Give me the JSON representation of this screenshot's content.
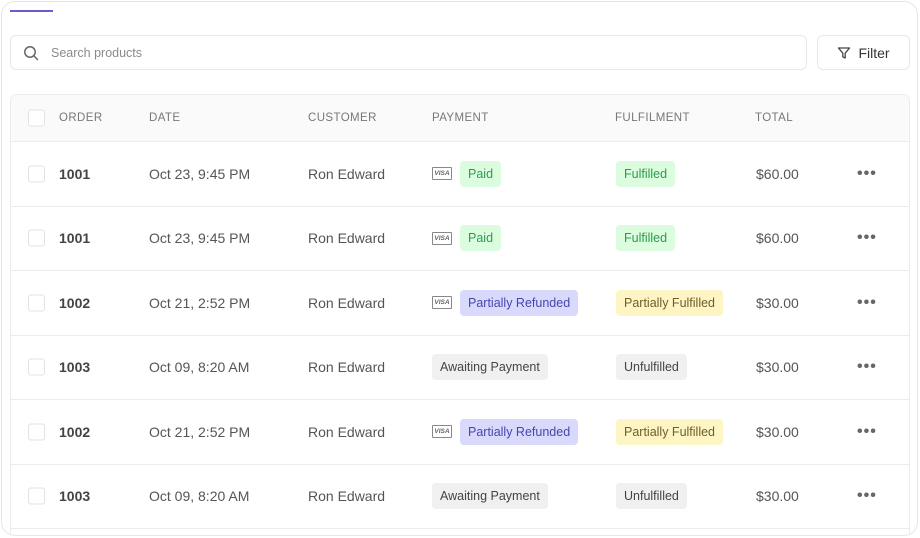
{
  "search": {
    "placeholder": "Search products",
    "value": ""
  },
  "toolbar": {
    "filter_label": "Filter"
  },
  "colors": {
    "accent": "#6b5bd2",
    "paid_bg": "#dcfce0",
    "paid_fg": "#2e9a4e",
    "refund_bg": "#d9d9fb",
    "refund_fg": "#4a44b0",
    "partial_bg": "#fdf5c4",
    "partial_fg": "#6f5e2a",
    "neutral_bg": "#f0f0f0",
    "neutral_fg": "#444444"
  },
  "table": {
    "columns": [
      "ORDER",
      "DATE",
      "CUSTOMER",
      "PAYMENT",
      "FULFILMENT",
      "TOTAL"
    ],
    "rows": [
      {
        "order": "1001",
        "date": "Oct 23,  9:45 PM",
        "customer": "Ron Edward",
        "card": "VISA",
        "payment": "Paid",
        "payment_kind": "paid",
        "fulfilment": "Fulfilled",
        "fulfilment_kind": "paid",
        "total": "$60.00"
      },
      {
        "order": "1001",
        "date": "Oct 23,  9:45 PM",
        "customer": "Ron Edward",
        "card": "VISA",
        "payment": "Paid",
        "payment_kind": "paid",
        "fulfilment": "Fulfilled",
        "fulfilment_kind": "paid",
        "total": "$60.00"
      },
      {
        "order": "1002",
        "date": "Oct 21,  2:52 PM",
        "customer": "Ron Edward",
        "card": "VISA",
        "payment": "Partially Refunded",
        "payment_kind": "refund",
        "fulfilment": "Partially Fulfilled",
        "fulfilment_kind": "partial",
        "total": "$30.00"
      },
      {
        "order": "1003",
        "date": "Oct 09,  8:20 AM",
        "customer": "Ron Edward",
        "card": "",
        "payment": "Awaiting Payment",
        "payment_kind": "neutral",
        "fulfilment": "Unfulfilled",
        "fulfilment_kind": "neutral",
        "total": "$30.00"
      },
      {
        "order": "1002",
        "date": "Oct 21,  2:52 PM",
        "customer": "Ron Edward",
        "card": "VISA",
        "payment": "Partially Refunded",
        "payment_kind": "refund",
        "fulfilment": "Partially Fulfilled",
        "fulfilment_kind": "partial",
        "total": "$30.00"
      },
      {
        "order": "1003",
        "date": "Oct 09,  8:20 AM",
        "customer": "Ron Edward",
        "card": "",
        "payment": "Awaiting Payment",
        "payment_kind": "neutral",
        "fulfilment": "Unfulfilled",
        "fulfilment_kind": "neutral",
        "total": "$30.00"
      }
    ],
    "row_action_label": "•••"
  }
}
